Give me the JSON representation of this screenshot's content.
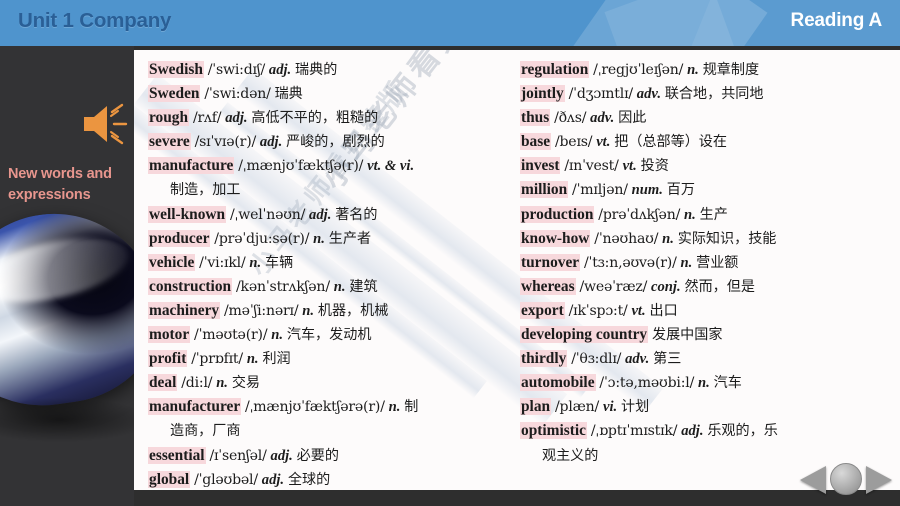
{
  "header": {
    "unit_title": "Unit 1 Company",
    "reading_title": "Reading A"
  },
  "sidebar": {
    "speaker_icon": "speaker-icon",
    "section_label": "New words and expressions",
    "photo": "car-photo"
  },
  "watermark": {
    "line1": "小马老师看完整版",
    "line2": "小马老师看完整版"
  },
  "nav": {
    "prev_label": "previous-slide",
    "home_label": "home",
    "next_label": "next-slide"
  },
  "wordlist": {
    "left_column": [
      {
        "headword": "Swedish",
        "ipa": "/ˈswi:dɪʃ/",
        "pos": "adj.",
        "meaning": "瑞典的"
      },
      {
        "headword": "Sweden",
        "ipa": "/ˈswi:dən/",
        "pos": "",
        "meaning": "瑞典"
      },
      {
        "headword": "rough",
        "ipa": "/rʌf/",
        "pos": "adj.",
        "meaning": "高低不平的，粗糙的"
      },
      {
        "headword": "severe",
        "ipa": "/sɪˈvɪə(r)/",
        "pos": "adj.",
        "meaning": "严峻的，剧烈的"
      },
      {
        "headword": "manufacture",
        "ipa": "/ˌmænjʊˈfæktʃə(r)/",
        "pos": "vt. & vi.",
        "meaning": "",
        "continuation": "制造，加工"
      },
      {
        "headword": "well-known",
        "ipa": "/ˌwelˈnəʊn/",
        "pos": "adj.",
        "meaning": "著名的"
      },
      {
        "headword": "producer",
        "ipa": "/prəˈdju:sə(r)/",
        "pos": "n.",
        "meaning": "生产者"
      },
      {
        "headword": "vehicle",
        "ipa": "/ˈvi:ɪkl/",
        "pos": "n.",
        "meaning": "车辆"
      },
      {
        "headword": "construction",
        "ipa": "/kənˈstrʌkʃən/",
        "pos": "n.",
        "meaning": "建筑"
      },
      {
        "headword": "machinery",
        "ipa": "/məˈʃi:nərɪ/",
        "pos": "n.",
        "meaning": "机器，机械"
      },
      {
        "headword": "motor",
        "ipa": "/ˈməʊtə(r)/",
        "pos": "n.",
        "meaning": "汽车，发动机"
      },
      {
        "headword": "profit",
        "ipa": "/ˈprɒfɪt/",
        "pos": "n.",
        "meaning": "利润"
      },
      {
        "headword": "deal",
        "ipa": "/di:l/",
        "pos": "n.",
        "meaning": "交易"
      },
      {
        "headword": "manufacturer",
        "ipa": "/ˌmænjʊˈfæktʃərə(r)/",
        "pos": "n.",
        "meaning": "制",
        "continuation": "造商，厂商"
      },
      {
        "headword": "essential",
        "ipa": "/ɪˈsenʃəl/",
        "pos": "adj.",
        "meaning": "必要的"
      },
      {
        "headword": "global",
        "ipa": "/ˈgləʊbəl/",
        "pos": "adj.",
        "meaning": "全球的"
      }
    ],
    "right_column": [
      {
        "headword": "regulation",
        "ipa": "/ˌregjʊˈleɪʃən/",
        "pos": "n.",
        "meaning": "规章制度"
      },
      {
        "headword": "jointly",
        "ipa": "/ˈdʒɔɪntlɪ/",
        "pos": "adv.",
        "meaning": "联合地，共同地"
      },
      {
        "headword": "thus",
        "ipa": "/ðʌs/",
        "pos": "adv.",
        "meaning": "因此"
      },
      {
        "headword": "base",
        "ipa": "/beɪs/",
        "pos": "vt.",
        "meaning": "把（总部等）设在"
      },
      {
        "headword": "invest",
        "ipa": "/ɪnˈvest/",
        "pos": "vt.",
        "meaning": "投资"
      },
      {
        "headword": "million",
        "ipa": "/ˈmɪljən/",
        "pos": "num.",
        "meaning": "百万"
      },
      {
        "headword": "production",
        "ipa": "/prəˈdʌkʃən/",
        "pos": "n.",
        "meaning": "生产"
      },
      {
        "headword": "know-how",
        "ipa": "/ˈnəʊhaʊ/",
        "pos": "n.",
        "meaning": "实际知识，技能"
      },
      {
        "headword": "turnover",
        "ipa": "/ˈtɜ:n,əʊvə(r)/",
        "pos": "n.",
        "meaning": "营业额"
      },
      {
        "headword": "whereas",
        "ipa": "/weəˈræz/",
        "pos": "conj.",
        "meaning": "然而，但是"
      },
      {
        "headword": "export",
        "ipa": "/ɪkˈspɔ:t/",
        "pos": "vt.",
        "meaning": "出口"
      },
      {
        "headword": "developing country",
        "ipa": "",
        "pos": "",
        "meaning": "发展中国家"
      },
      {
        "headword": "thirdly",
        "ipa": "/ˈθɜ:dlɪ/",
        "pos": "adv.",
        "meaning": "第三"
      },
      {
        "headword": "automobile",
        "ipa": "/ˈɔ:tə,məʊbi:l/",
        "pos": "n.",
        "meaning": "汽车"
      },
      {
        "headword": "plan",
        "ipa": "/plæn/",
        "pos": "vi.",
        "meaning": "计划"
      },
      {
        "headword": "optimistic",
        "ipa": "/ˌɒptɪˈmɪstɪk/",
        "pos": "adj.",
        "meaning": "乐观的，乐",
        "continuation": "观主义的"
      }
    ]
  }
}
